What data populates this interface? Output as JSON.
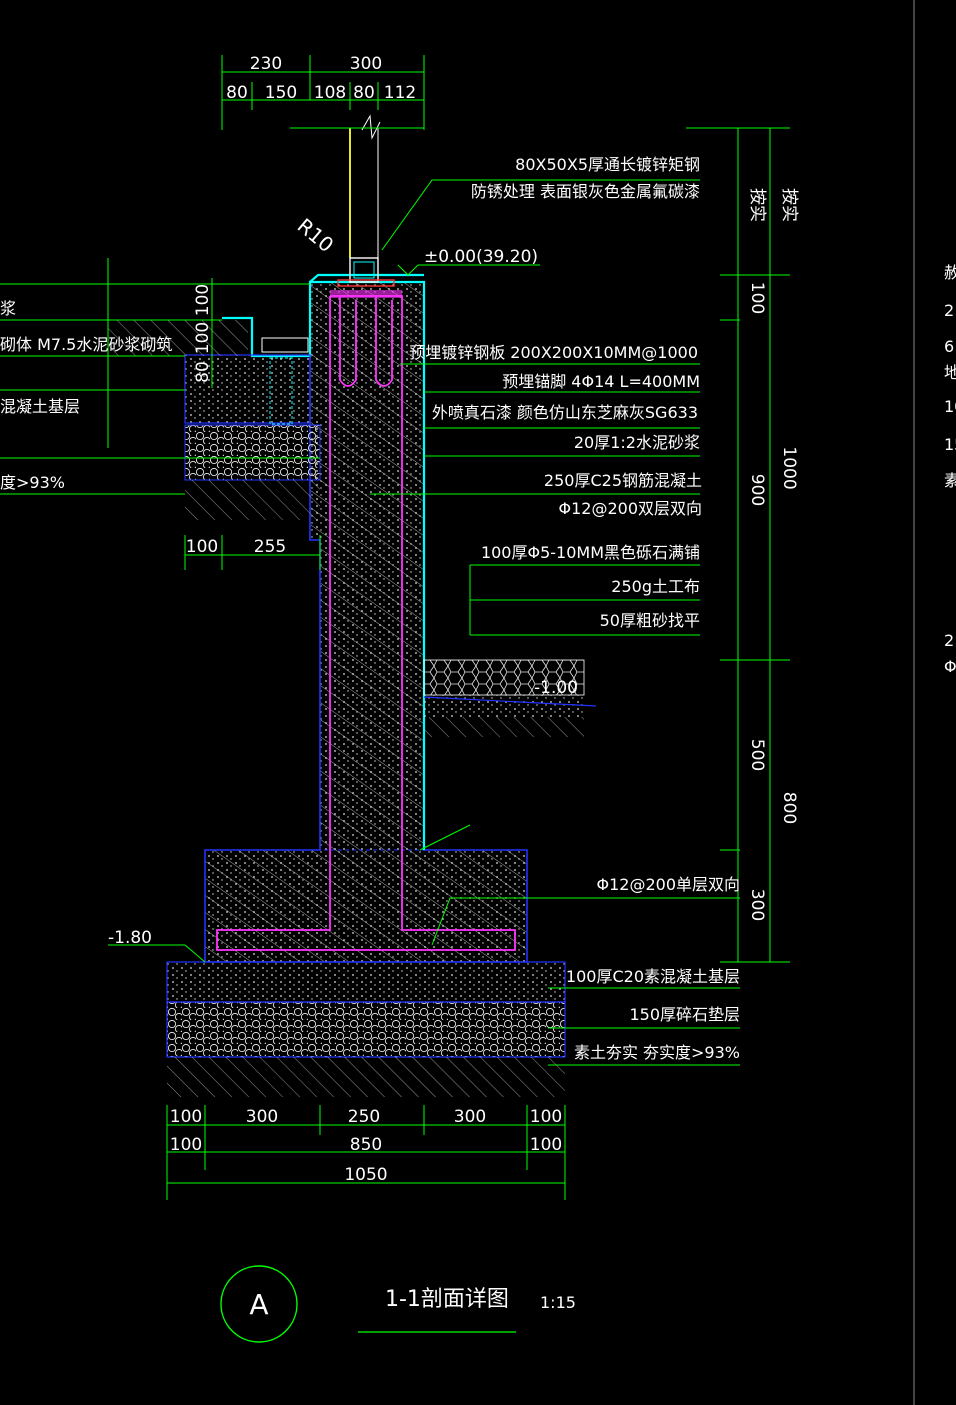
{
  "top_dims": {
    "row1": [
      "230",
      "300"
    ],
    "row2": [
      "80",
      "150",
      "108",
      "80",
      "112"
    ]
  },
  "radius_label": "R10",
  "elevation_top": "±0.00(39.20)",
  "elevation_water": "-1.00",
  "elevation_bottom": "-1.80",
  "right_notes": [
    "80X50X5厚通长镀锌矩钢",
    "防锈处理 表面银灰色金属氟碳漆",
    "预埋镀锌钢板 200X200X10MM@1000",
    "预埋锚脚 4Φ14 L=400MM",
    "外喷真石漆 颜色仿山东芝麻灰SG633",
    "20厚1:2水泥砂浆",
    "250厚C25钢筋混凝土",
    "Φ12@200双层双向",
    "100厚Φ5-10MM黑色砾石满铺",
    "250g土工布",
    "50厚粗砂找平",
    "Φ12@200单层双向",
    "100厚C20素混凝土基层",
    "150厚碎石垫层",
    "素土夯实 夯实度>93%"
  ],
  "left_notes": [
    "浆",
    "砌体 M7.5水泥砂浆砌筑",
    "混凝土基层",
    "度>93%"
  ],
  "left_vert_dims": [
    "100",
    "100",
    "80"
  ],
  "left_bottom_dims": [
    "100",
    "255"
  ],
  "right_vert_dims": {
    "inner": [
      "按实",
      "100",
      "900",
      "500",
      "300"
    ],
    "outer": [
      "按实",
      "1000",
      "800"
    ]
  },
  "bottom_dims": {
    "row1": [
      "100",
      "300",
      "250",
      "300",
      "100"
    ],
    "row2": [
      "100",
      "850",
      "100"
    ],
    "row3": [
      "1050"
    ]
  },
  "title": {
    "circle_label": "A",
    "name": "1-1剖面详图",
    "scale": "1:15"
  },
  "right_edge_fragments": [
    "赦",
    "2",
    "6",
    "地",
    "10",
    "15",
    "素",
    "2",
    "Φ"
  ],
  "colors": {
    "dim": "#00ff00",
    "wall": "#0000ff",
    "rebar": "#ff00ff",
    "finish": "#00ffff",
    "railing": "#ffff00",
    "hatch": "#ffffff"
  }
}
